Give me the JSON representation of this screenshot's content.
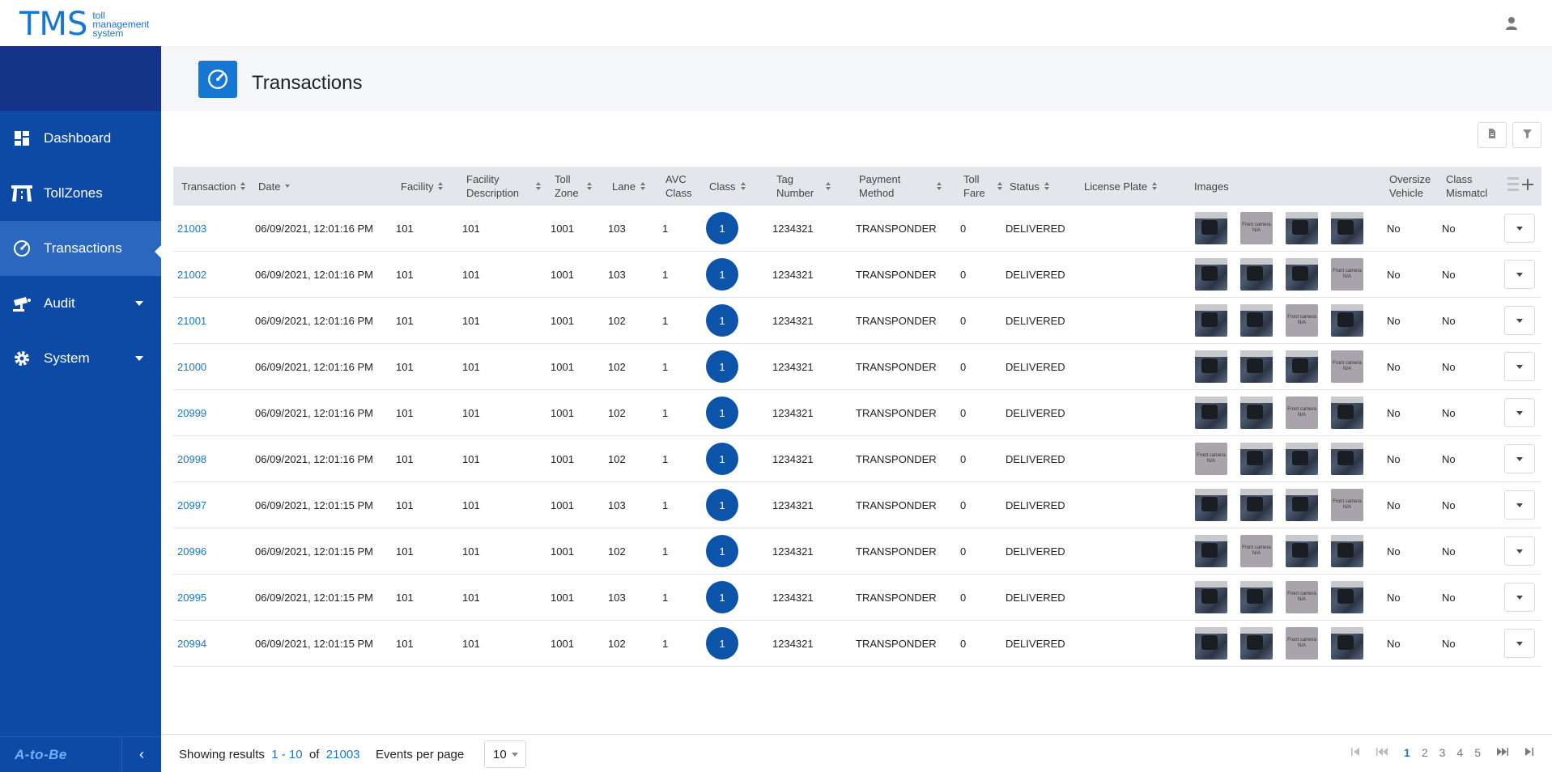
{
  "app": {
    "logo_main": "TMS",
    "logo_sub": [
      "toll",
      "management",
      "system"
    ]
  },
  "sidebar": {
    "items": [
      {
        "label": "Dashboard",
        "icon": "dashboard-icon"
      },
      {
        "label": "TollZones",
        "icon": "tollzone-icon"
      },
      {
        "label": "Transactions",
        "icon": "speedometer-icon",
        "active": true
      },
      {
        "label": "Audit",
        "icon": "camera-icon",
        "has_submenu": true
      },
      {
        "label": "System",
        "icon": "gear-icon",
        "has_submenu": true
      }
    ],
    "footer_brand": "A-to-Be",
    "collapse_glyph": "‹"
  },
  "page": {
    "title": "Transactions"
  },
  "table": {
    "columns": [
      {
        "key": "transaction",
        "label": "Transaction"
      },
      {
        "key": "date",
        "label": "Date"
      },
      {
        "key": "facility",
        "label": "Facility"
      },
      {
        "key": "facility_desc",
        "label": "Facility Description"
      },
      {
        "key": "toll_zone",
        "label": "Toll Zone"
      },
      {
        "key": "lane",
        "label": "Lane"
      },
      {
        "key": "avc_class",
        "label": "AVC Class"
      },
      {
        "key": "class",
        "label": "Class"
      },
      {
        "key": "tag_number",
        "label": "Tag Number"
      },
      {
        "key": "payment_method",
        "label": "Payment Method"
      },
      {
        "key": "toll_fare",
        "label": "Toll Fare"
      },
      {
        "key": "status",
        "label": "Status"
      },
      {
        "key": "license_plate",
        "label": "License Plate"
      },
      {
        "key": "images",
        "label": "Images"
      },
      {
        "key": "oversize",
        "label": "Oversize Vehicle"
      },
      {
        "key": "class_mismatch",
        "label": "Class Mismatcl"
      }
    ],
    "na_label": "Front camera N/A",
    "rows": [
      {
        "transaction": "21003",
        "date": "06/09/2021, 12:01:16 PM",
        "facility": "101",
        "facility_desc": "101",
        "toll_zone": "1001",
        "lane": "103",
        "avc_class": "1",
        "class": "1",
        "tag_number": "1234321",
        "payment_method": "TRANSPONDER",
        "toll_fare": "0",
        "status": "DELIVERED",
        "license_plate": "",
        "images": [
          "photo",
          "na",
          "photo",
          "photo"
        ],
        "oversize": "No",
        "class_mismatch": "No"
      },
      {
        "transaction": "21002",
        "date": "06/09/2021, 12:01:16 PM",
        "facility": "101",
        "facility_desc": "101",
        "toll_zone": "1001",
        "lane": "103",
        "avc_class": "1",
        "class": "1",
        "tag_number": "1234321",
        "payment_method": "TRANSPONDER",
        "toll_fare": "0",
        "status": "DELIVERED",
        "license_plate": "",
        "images": [
          "photo",
          "photo",
          "photo",
          "na"
        ],
        "oversize": "No",
        "class_mismatch": "No"
      },
      {
        "transaction": "21001",
        "date": "06/09/2021, 12:01:16 PM",
        "facility": "101",
        "facility_desc": "101",
        "toll_zone": "1001",
        "lane": "102",
        "avc_class": "1",
        "class": "1",
        "tag_number": "1234321",
        "payment_method": "TRANSPONDER",
        "toll_fare": "0",
        "status": "DELIVERED",
        "license_plate": "",
        "images": [
          "photo",
          "photo",
          "na",
          "photo"
        ],
        "oversize": "No",
        "class_mismatch": "No"
      },
      {
        "transaction": "21000",
        "date": "06/09/2021, 12:01:16 PM",
        "facility": "101",
        "facility_desc": "101",
        "toll_zone": "1001",
        "lane": "102",
        "avc_class": "1",
        "class": "1",
        "tag_number": "1234321",
        "payment_method": "TRANSPONDER",
        "toll_fare": "0",
        "status": "DELIVERED",
        "license_plate": "",
        "images": [
          "photo",
          "photo",
          "photo",
          "na"
        ],
        "oversize": "No",
        "class_mismatch": "No"
      },
      {
        "transaction": "20999",
        "date": "06/09/2021, 12:01:16 PM",
        "facility": "101",
        "facility_desc": "101",
        "toll_zone": "1001",
        "lane": "102",
        "avc_class": "1",
        "class": "1",
        "tag_number": "1234321",
        "payment_method": "TRANSPONDER",
        "toll_fare": "0",
        "status": "DELIVERED",
        "license_plate": "",
        "images": [
          "photo",
          "photo",
          "na",
          "photo"
        ],
        "oversize": "No",
        "class_mismatch": "No"
      },
      {
        "transaction": "20998",
        "date": "06/09/2021, 12:01:16 PM",
        "facility": "101",
        "facility_desc": "101",
        "toll_zone": "1001",
        "lane": "102",
        "avc_class": "1",
        "class": "1",
        "tag_number": "1234321",
        "payment_method": "TRANSPONDER",
        "toll_fare": "0",
        "status": "DELIVERED",
        "license_plate": "",
        "images": [
          "na",
          "photo",
          "photo",
          "photo"
        ],
        "oversize": "No",
        "class_mismatch": "No"
      },
      {
        "transaction": "20997",
        "date": "06/09/2021, 12:01:15 PM",
        "facility": "101",
        "facility_desc": "101",
        "toll_zone": "1001",
        "lane": "103",
        "avc_class": "1",
        "class": "1",
        "tag_number": "1234321",
        "payment_method": "TRANSPONDER",
        "toll_fare": "0",
        "status": "DELIVERED",
        "license_plate": "",
        "images": [
          "photo",
          "photo",
          "photo",
          "na"
        ],
        "oversize": "No",
        "class_mismatch": "No"
      },
      {
        "transaction": "20996",
        "date": "06/09/2021, 12:01:15 PM",
        "facility": "101",
        "facility_desc": "101",
        "toll_zone": "1001",
        "lane": "102",
        "avc_class": "1",
        "class": "1",
        "tag_number": "1234321",
        "payment_method": "TRANSPONDER",
        "toll_fare": "0",
        "status": "DELIVERED",
        "license_plate": "",
        "images": [
          "photo",
          "na",
          "photo",
          "photo"
        ],
        "oversize": "No",
        "class_mismatch": "No"
      },
      {
        "transaction": "20995",
        "date": "06/09/2021, 12:01:15 PM",
        "facility": "101",
        "facility_desc": "101",
        "toll_zone": "1001",
        "lane": "103",
        "avc_class": "1",
        "class": "1",
        "tag_number": "1234321",
        "payment_method": "TRANSPONDER",
        "toll_fare": "0",
        "status": "DELIVERED",
        "license_plate": "",
        "images": [
          "photo",
          "photo",
          "na",
          "photo"
        ],
        "oversize": "No",
        "class_mismatch": "No"
      },
      {
        "transaction": "20994",
        "date": "06/09/2021, 12:01:15 PM",
        "facility": "101",
        "facility_desc": "101",
        "toll_zone": "1001",
        "lane": "102",
        "avc_class": "1",
        "class": "1",
        "tag_number": "1234321",
        "payment_method": "TRANSPONDER",
        "toll_fare": "0",
        "status": "DELIVERED",
        "license_plate": "",
        "images": [
          "photo",
          "photo",
          "na",
          "photo"
        ],
        "oversize": "No",
        "class_mismatch": "No"
      }
    ]
  },
  "footer": {
    "showing_prefix": "Showing results",
    "range": "1 - 10",
    "of_label": "of",
    "total": "21003",
    "events_per_page_label": "Events per page",
    "events_per_page_value": "10",
    "pages": [
      "1",
      "2",
      "3",
      "4",
      "5"
    ],
    "current_page": "1"
  }
}
